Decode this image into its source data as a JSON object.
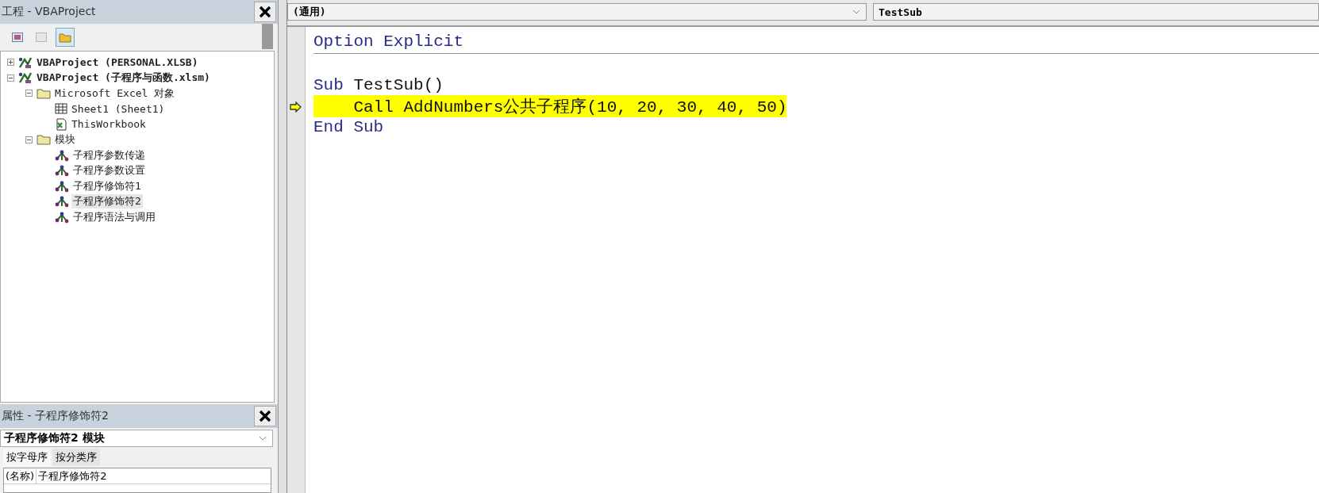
{
  "project_pane": {
    "title": "工程 - VBAProject",
    "toolbar": [
      {
        "kind": "view-code",
        "selected": false
      },
      {
        "kind": "view-object",
        "selected": false
      },
      {
        "kind": "toggle-folders",
        "selected": true
      }
    ],
    "tree": [
      {
        "label": "VBAProject (PERSONAL.XLSB)",
        "kind": "project",
        "expanded": false,
        "selected": false
      },
      {
        "label": "VBAProject (子程序与函数.xlsm)",
        "kind": "project",
        "expanded": true,
        "selected": false,
        "children": [
          {
            "label": "Microsoft Excel 对象",
            "kind": "folder",
            "expanded": true,
            "selected": false,
            "children": [
              {
                "label": "Sheet1 (Sheet1)",
                "kind": "sheet",
                "selected": false
              },
              {
                "label": "ThisWorkbook",
                "kind": "workbook",
                "selected": false
              }
            ]
          },
          {
            "label": "模块",
            "kind": "folder",
            "expanded": true,
            "selected": false,
            "children": [
              {
                "label": "子程序参数传递",
                "kind": "module",
                "selected": false
              },
              {
                "label": "子程序参数设置",
                "kind": "module",
                "selected": false
              },
              {
                "label": "子程序修饰符1",
                "kind": "module",
                "selected": false
              },
              {
                "label": "子程序修饰符2",
                "kind": "module",
                "selected": true
              },
              {
                "label": "子程序语法与调用",
                "kind": "module",
                "selected": false
              }
            ]
          }
        ]
      }
    ]
  },
  "properties_pane": {
    "title": "属性 - 子程序修饰符2",
    "object_select": "子程序修饰符2 模块",
    "tabs": [
      {
        "label": "按字母序",
        "selected": true
      },
      {
        "label": "按分类序",
        "selected": false
      }
    ],
    "rows": [
      {
        "name": "(名称)",
        "value": "子程序修饰符2"
      }
    ]
  },
  "code_window": {
    "object_select": "(通用)",
    "procedure_select": "TestSub",
    "lines": [
      {
        "tokens": [
          {
            "text": "Option Explicit",
            "kind": "keyword"
          }
        ],
        "separator": true,
        "current": false
      },
      {
        "separator": false,
        "current": false
      },
      {
        "tokens": [
          {
            "text": "Sub",
            "kind": "keyword"
          },
          {
            "text": " TestSub()",
            "kind": "plain"
          }
        ],
        "separator": false,
        "current": false
      },
      {
        "tokens": [
          {
            "text": "    Call AddNumbers公共子程序(10, 20, 30, 40, 50)",
            "kind": "plain"
          }
        ],
        "separator": false,
        "current": true
      },
      {
        "tokens": [
          {
            "text": "End Sub",
            "kind": "keyword"
          }
        ],
        "separator": false,
        "current": false
      }
    ]
  }
}
